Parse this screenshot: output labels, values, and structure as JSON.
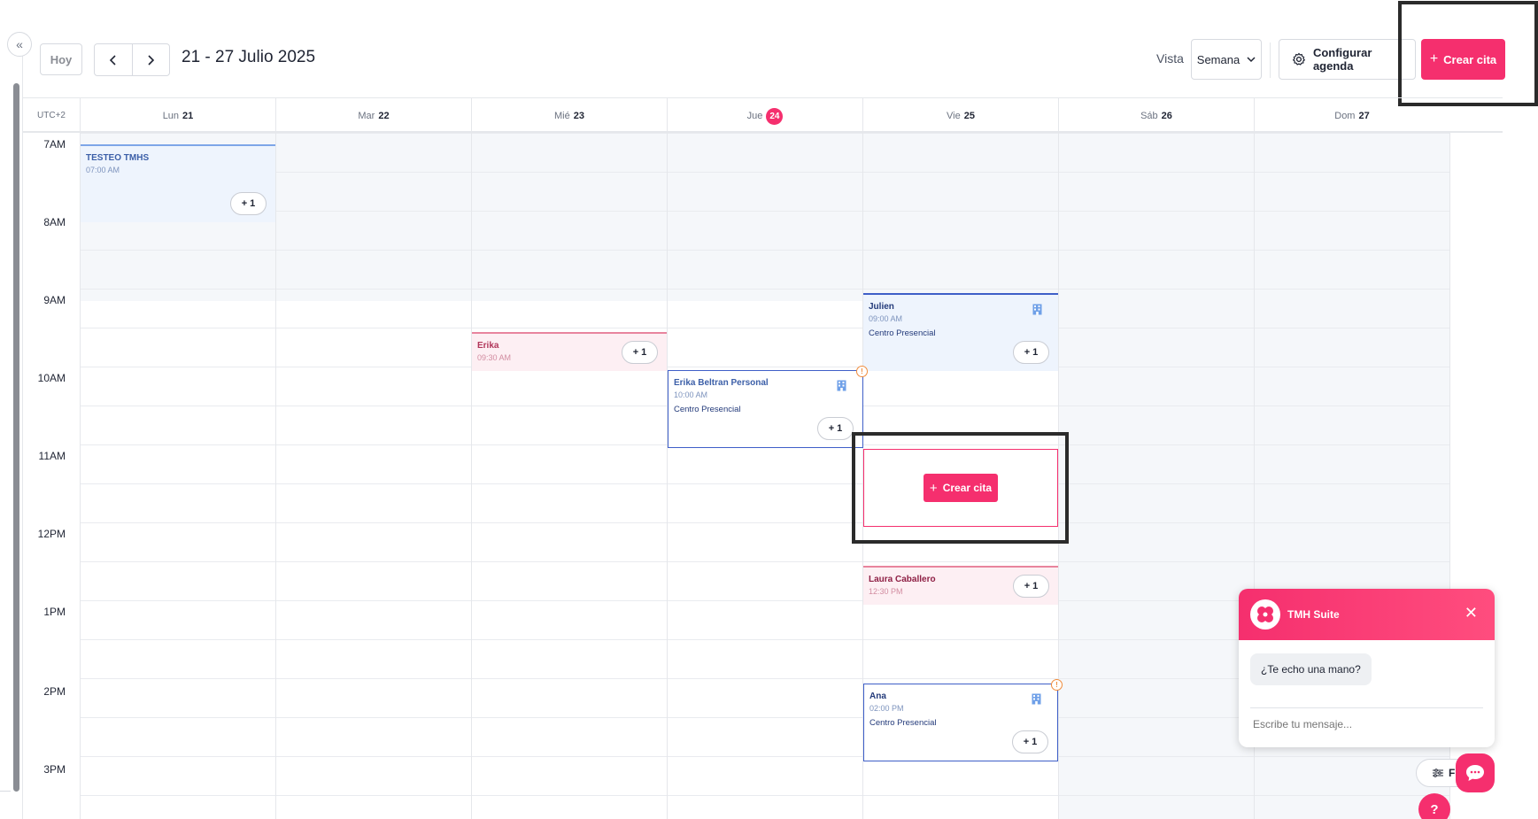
{
  "toolbar": {
    "today_label": "Hoy",
    "prev_icon": "chevron-left-icon",
    "next_icon": "chevron-right-icon",
    "range_title": "21 - 27 Julio 2025",
    "view_label": "Vista",
    "view_value": "Semana",
    "config_label": "Configurar agenda",
    "create_label": "Crear cita"
  },
  "calendar": {
    "timezone": "UTC+2",
    "days": [
      {
        "name": "Lun",
        "num": "21",
        "today": false
      },
      {
        "name": "Mar",
        "num": "22",
        "today": false
      },
      {
        "name": "Mié",
        "num": "23",
        "today": false
      },
      {
        "name": "Jue",
        "num": "24",
        "today": true
      },
      {
        "name": "Vie",
        "num": "25",
        "today": false
      },
      {
        "name": "Sáb",
        "num": "26",
        "today": false
      },
      {
        "name": "Dom",
        "num": "27",
        "today": false
      }
    ],
    "hours": [
      "7AM",
      "8AM",
      "9AM",
      "10AM",
      "11AM",
      "12PM",
      "1PM",
      "2PM",
      "3PM"
    ],
    "events": [
      {
        "title": "TESTEO TMHS",
        "time": "07:00 AM",
        "location": "",
        "more": "+ 1"
      },
      {
        "title": "Erika",
        "time": "09:30 AM",
        "location": "",
        "more": "+ 1"
      },
      {
        "title": "Julien",
        "time": "09:00 AM",
        "location": "Centro Presencial",
        "more": "+ 1"
      },
      {
        "title": "Erika Beltran Personal",
        "time": "10:00 AM",
        "location": "Centro Presencial",
        "more": "+ 1"
      },
      {
        "title": "Laura Caballero",
        "time": "12:30 PM",
        "location": "",
        "more": "+ 1"
      },
      {
        "title": "Ana",
        "time": "02:00 PM",
        "location": "Centro Presencial",
        "more": "+ 1"
      }
    ],
    "slot_create_label": "Crear cita"
  },
  "chat": {
    "brand": "TMH Suite",
    "greeting": "¿Te echo una mano?",
    "input_placeholder": "Escribe tu mensaje..."
  },
  "filter_label": "Fil",
  "help_label": "?",
  "colors": {
    "accent": "#f52f6e",
    "event_blue_bg": "#eef4fd",
    "event_pink_bg": "#fdeff3",
    "event_outline": "#3f5fc8",
    "alert": "#f08c3c"
  }
}
